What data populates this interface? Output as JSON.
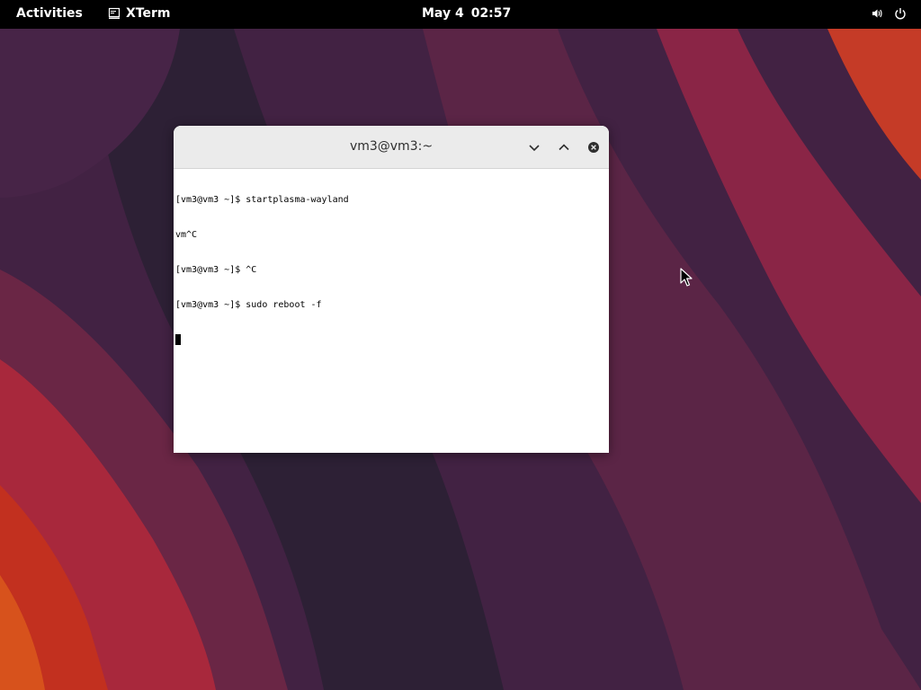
{
  "topbar": {
    "activities": "Activities",
    "app_name": "XTerm",
    "app_icon": "terminal-icon",
    "date": "May 4",
    "time": "02:57",
    "volume_icon": "volume-icon",
    "power_icon": "power-icon"
  },
  "window": {
    "title": "vm3@vm3:~",
    "minimize_icon": "chevron-down-icon",
    "maximize_icon": "chevron-up-icon",
    "close_icon": "close-icon"
  },
  "terminal": {
    "lines": [
      "[vm3@vm3 ~]$ startplasma-wayland",
      "vm^C",
      "[vm3@vm3 ~]$ ^C",
      "[vm3@vm3 ~]$ sudo reboot -f"
    ]
  },
  "colors": {
    "wallpaper_dark": "#2c1f33",
    "wallpaper_mid": "#5a2647",
    "wallpaper_red": "#b0273a",
    "wallpaper_orange": "#d9461f"
  }
}
